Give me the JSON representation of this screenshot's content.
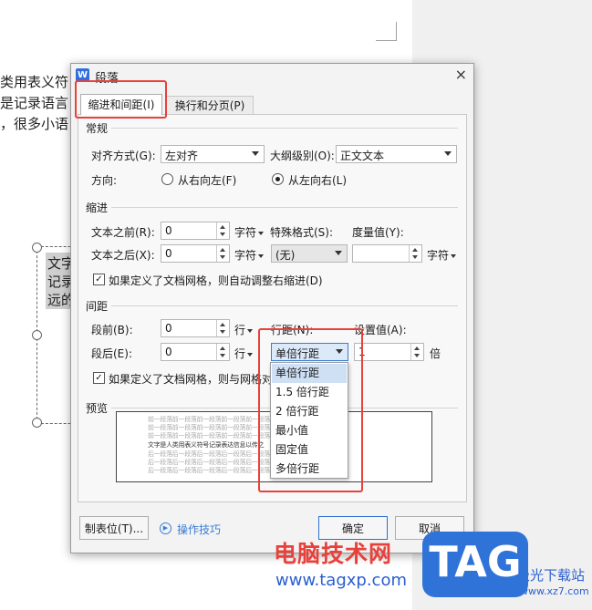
{
  "document": {
    "lines": [
      "类用表义符",
      "是记录语言",
      "，很多小语"
    ],
    "textbox_lines": [
      "文字",
      "记录",
      "远的"
    ]
  },
  "dialog": {
    "title": "段落",
    "app_icon": "W",
    "close": "×",
    "tabs": [
      "缩进和间距(I)",
      "换行和分页(P)"
    ],
    "general": {
      "title": "常规",
      "align_label": "对齐方式(G):",
      "align_value": "左对齐",
      "outline_label": "大纲级别(O):",
      "outline_value": "正文文本",
      "direction_label": "方向:",
      "rtl": "从右向左(F)",
      "ltr": "从左向右(L)"
    },
    "indent": {
      "title": "缩进",
      "before_label": "文本之前(R):",
      "before_value": "0",
      "after_label": "文本之后(X):",
      "after_value": "0",
      "unit": "字符",
      "special_label": "特殊格式(S):",
      "special_value": "(无)",
      "measure_label": "度量值(Y):",
      "measure_value": "",
      "grid_checkbox": "如果定义了文档网格，则自动调整右缩进(D)"
    },
    "spacing": {
      "title": "间距",
      "before_label": "段前(B):",
      "before_value": "0",
      "after_label": "段后(E):",
      "after_value": "0",
      "unit": "行",
      "line_label": "行距(N):",
      "line_value": "单倍行距",
      "setting_label": "设置值(A):",
      "setting_value": "1",
      "setting_unit": "倍",
      "grid_checkbox": "如果定义了文档网格，则与网格对"
    },
    "preview": {
      "title": "预览",
      "prev_line": "前一段落前一段落前一段落前一段落前一段落前一段落前一段落前一段落",
      "main_line": "文字是人类用表义符号记录表达信息以传之",
      "next_line": "后一段落后一段落后一段落后一段落后一段落后一段落后一段落后一段落"
    },
    "buttons": {
      "tabs": "制表位(T)...",
      "tips": "操作技巧",
      "ok": "确定",
      "cancel": "取消"
    }
  },
  "dropdown": {
    "items": [
      "单倍行距",
      "1.5 倍行距",
      "2 倍行距",
      "最小值",
      "固定值",
      "多倍行距"
    ],
    "selected": "单倍行距"
  },
  "watermark": {
    "site_name": "电脑技术网",
    "url": "www.tagxp.com",
    "logo": "TAG",
    "side_text": "极光下载站",
    "side_url": "www.xz7.com"
  },
  "colors": {
    "highlight": "#e8413b",
    "accent": "#2f73d9",
    "selection": "#cfe0f5"
  }
}
